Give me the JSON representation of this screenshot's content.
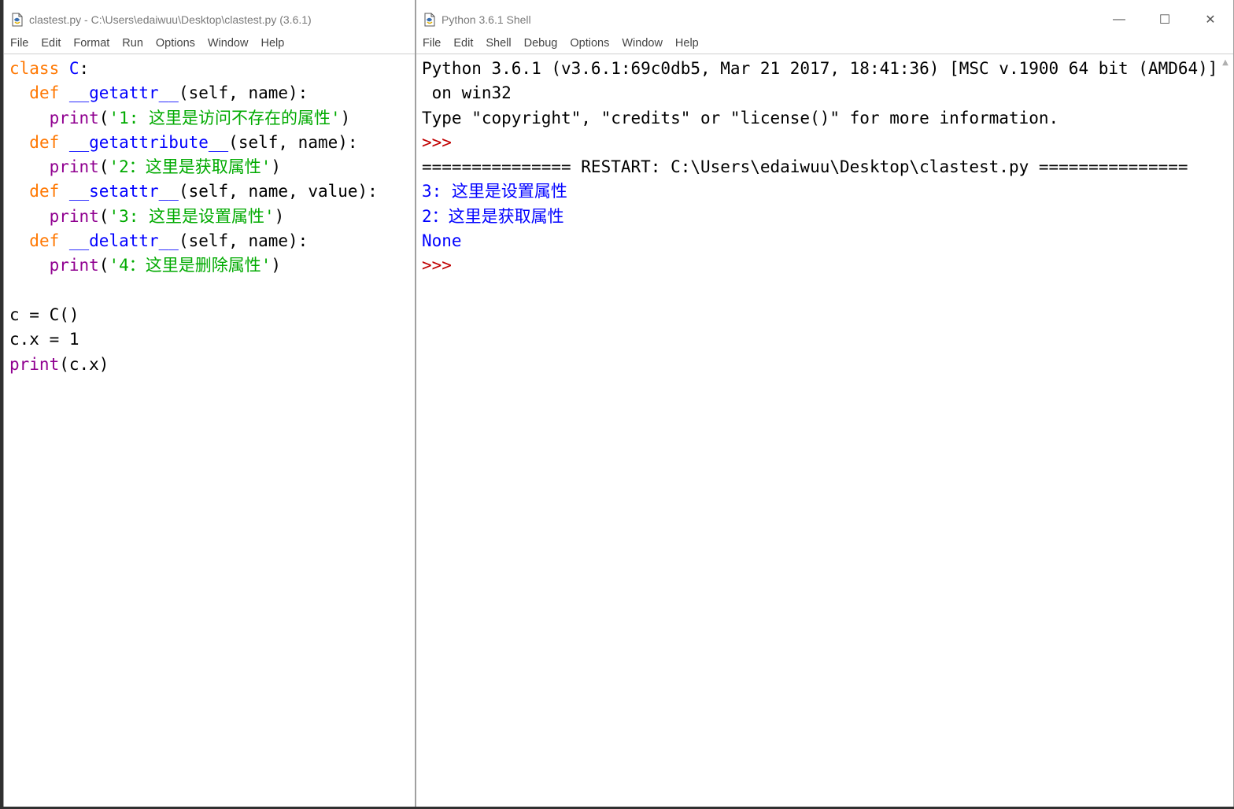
{
  "editor": {
    "title": "clastest.py - C:\\Users\\edaiwuu\\Desktop\\clastest.py (3.6.1)",
    "menu": [
      "File",
      "Edit",
      "Format",
      "Run",
      "Options",
      "Window",
      "Help"
    ],
    "code": [
      [
        {
          "t": "class ",
          "c": "kw"
        },
        {
          "t": "C",
          "c": "def"
        },
        {
          "t": ":",
          "c": "plain"
        }
      ],
      [
        {
          "t": "  ",
          "c": "plain"
        },
        {
          "t": "def ",
          "c": "kw"
        },
        {
          "t": "__getattr__",
          "c": "def"
        },
        {
          "t": "(self, name):",
          "c": "plain"
        }
      ],
      [
        {
          "t": "    ",
          "c": "plain"
        },
        {
          "t": "print",
          "c": "bi"
        },
        {
          "t": "(",
          "c": "plain"
        },
        {
          "t": "'1: 这里是访问不存在的属性'",
          "c": "str"
        },
        {
          "t": ")",
          "c": "plain"
        }
      ],
      [
        {
          "t": "  ",
          "c": "plain"
        },
        {
          "t": "def ",
          "c": "kw"
        },
        {
          "t": "__getattribute__",
          "c": "def"
        },
        {
          "t": "(self, name):",
          "c": "plain"
        }
      ],
      [
        {
          "t": "    ",
          "c": "plain"
        },
        {
          "t": "print",
          "c": "bi"
        },
        {
          "t": "(",
          "c": "plain"
        },
        {
          "t": "'2：这里是获取属性'",
          "c": "str"
        },
        {
          "t": ")",
          "c": "plain"
        }
      ],
      [
        {
          "t": "  ",
          "c": "plain"
        },
        {
          "t": "def ",
          "c": "kw"
        },
        {
          "t": "__setattr__",
          "c": "def"
        },
        {
          "t": "(self, name, value):",
          "c": "plain"
        }
      ],
      [
        {
          "t": "    ",
          "c": "plain"
        },
        {
          "t": "print",
          "c": "bi"
        },
        {
          "t": "(",
          "c": "plain"
        },
        {
          "t": "'3: 这里是设置属性'",
          "c": "str"
        },
        {
          "t": ")",
          "c": "plain"
        }
      ],
      [
        {
          "t": "  ",
          "c": "plain"
        },
        {
          "t": "def ",
          "c": "kw"
        },
        {
          "t": "__delattr__",
          "c": "def"
        },
        {
          "t": "(self, name):",
          "c": "plain"
        }
      ],
      [
        {
          "t": "    ",
          "c": "plain"
        },
        {
          "t": "print",
          "c": "bi"
        },
        {
          "t": "(",
          "c": "plain"
        },
        {
          "t": "'4：这里是删除属性'",
          "c": "str"
        },
        {
          "t": ")",
          "c": "plain"
        }
      ],
      [],
      [
        {
          "t": "c = C()",
          "c": "plain"
        }
      ],
      [
        {
          "t": "c.x = 1",
          "c": "plain"
        }
      ],
      [
        {
          "t": "print",
          "c": "bi"
        },
        {
          "t": "(c.x)",
          "c": "plain"
        }
      ]
    ]
  },
  "shell": {
    "title": "Python 3.6.1 Shell",
    "menu": [
      "File",
      "Edit",
      "Shell",
      "Debug",
      "Options",
      "Window",
      "Help"
    ],
    "lines": [
      [
        {
          "t": "Python 3.6.1 (v3.6.1:69c0db5, Mar 21 2017, 18:41:36) [MSC v.1900 64 bit (AMD64)]",
          "c": "plain"
        }
      ],
      [
        {
          "t": " on win32",
          "c": "plain"
        }
      ],
      [
        {
          "t": "Type \"copyright\", \"credits\" or \"license()\" for more information.",
          "c": "plain"
        }
      ],
      [
        {
          "t": ">>> ",
          "c": "prompt"
        }
      ],
      [
        {
          "t": "=============== RESTART: C:\\Users\\edaiwuu\\Desktop\\clastest.py ===============",
          "c": "plain"
        }
      ],
      [
        {
          "t": "3: 这里是设置属性",
          "c": "out"
        }
      ],
      [
        {
          "t": "2：这里是获取属性",
          "c": "out"
        }
      ],
      [
        {
          "t": "None",
          "c": "out"
        }
      ],
      [
        {
          "t": ">>> ",
          "c": "prompt"
        }
      ]
    ],
    "controls": {
      "minimize": "—",
      "maximize": "☐",
      "close": "✕"
    }
  }
}
